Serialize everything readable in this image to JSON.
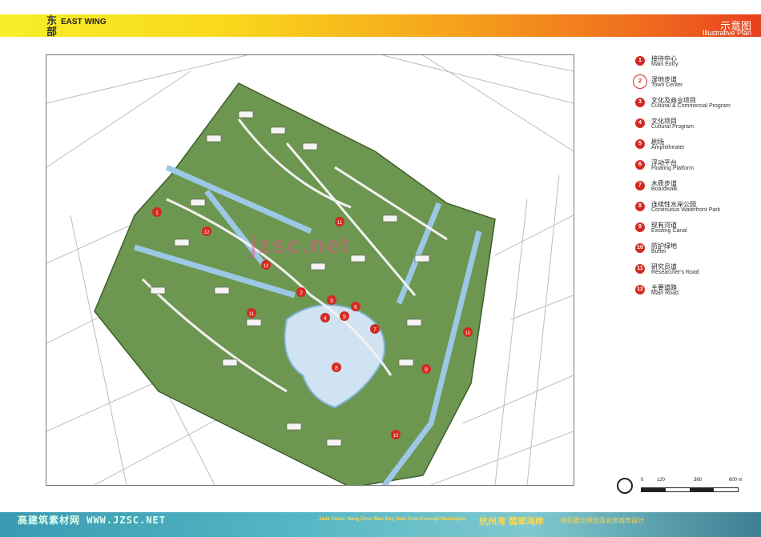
{
  "header": {
    "left_cn": "东部",
    "left_en": "EAST WING",
    "right_cn": "示意图",
    "right_en": "Illustrative Plan"
  },
  "legend": [
    {
      "num": "1",
      "cn": "接待中心",
      "en": "Main Entry"
    },
    {
      "num": "2",
      "cn": "湿地步道",
      "en": "Town Center"
    },
    {
      "num": "3",
      "cn": "文化及商业项目",
      "en": "Cultural & Commercial Program"
    },
    {
      "num": "4",
      "cn": "文化项目",
      "en": "Cultural Program"
    },
    {
      "num": "5",
      "cn": "剧场",
      "en": "Amphitheater"
    },
    {
      "num": "6",
      "cn": "浮动平台",
      "en": "Floating Platform"
    },
    {
      "num": "7",
      "cn": "木质步道",
      "en": "Boardwalk"
    },
    {
      "num": "8",
      "cn": "连续性水岸公园",
      "en": "Continuous Waterfront Park"
    },
    {
      "num": "9",
      "cn": "现有河道",
      "en": "Existing Canal"
    },
    {
      "num": "10",
      "cn": "防护绿地",
      "en": "Buffer"
    },
    {
      "num": "11",
      "cn": "研究员道",
      "en": "Researcher's Road"
    },
    {
      "num": "12",
      "cn": "主要道路",
      "en": "Main Road"
    }
  ],
  "scale": {
    "labels": [
      "0",
      "120",
      "360",
      "600 m"
    ]
  },
  "footer": {
    "watermark": "高建筑素材网 WWW.JZSC.NET",
    "project_en": "Jade Coast, Hang Zhou Wan Bay, New Zone Concept Masterplan",
    "project_cn": "杭州湾 翡翠海岸",
    "project_sub": "新区概念规划及总体城市设计"
  },
  "map_watermark": "jzsc.net",
  "colors": {
    "marker": "#d42a20",
    "green": "#5f8a45",
    "water": "#a9cde6"
  }
}
